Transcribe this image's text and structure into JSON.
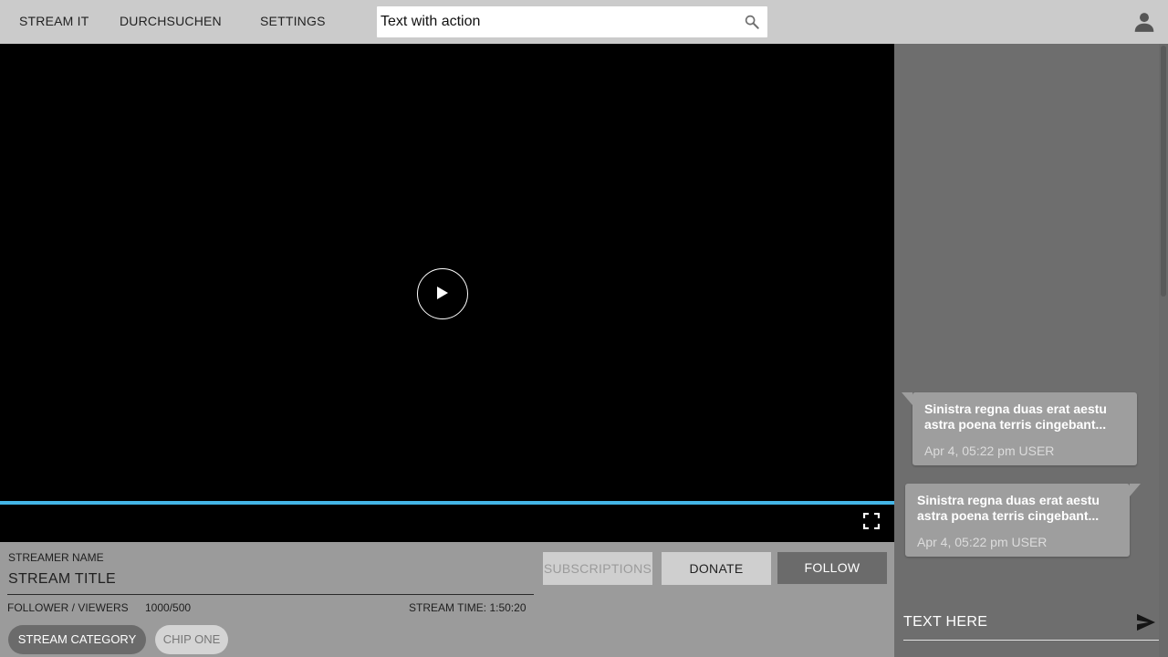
{
  "topbar": {
    "nav": [
      "STREAM IT",
      "DURCHSUCHEN",
      "SETTINGS"
    ],
    "search_value": "Text with action",
    "search_icon": "search-icon",
    "account_icon": "account-icon"
  },
  "video": {
    "play_icon": "play-icon",
    "fullscreen_icon": "fullscreen-icon",
    "accent_color": "#44b5e6"
  },
  "info": {
    "streamer_name": "STREAMER NAME",
    "stream_title": "STREAM TITLE",
    "follower_viewers_label": "FOLLOWER / VIEWERS",
    "follower_viewers_value": "1000/500",
    "stream_time": "STREAM TIME: 1:50:20",
    "buttons": {
      "subscriptions": "SUBSCRIPTIONS",
      "donate": "DONATE",
      "follow": "FOLLOW"
    },
    "chips": [
      "STREAM CATEGORY",
      "CHIP ONE"
    ]
  },
  "chat": {
    "messages": [
      {
        "text": "Sinistra regna duas erat aestu astra poena terris cingebant...",
        "meta": "Apr 4, 05:22 pm USER"
      },
      {
        "text": "Sinistra regna duas erat aestu astra poena terris cingebant...",
        "meta": "Apr 4, 05:22 pm USER"
      }
    ],
    "input_text": "TEXT HERE",
    "send_icon": "send-icon"
  }
}
